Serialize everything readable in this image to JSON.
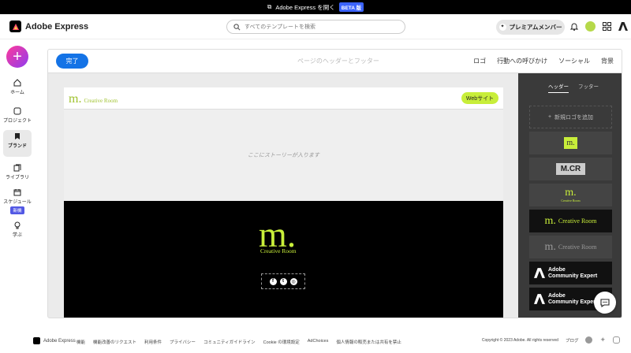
{
  "banner": {
    "text": "Adobe Express を開く",
    "badge": "BETA 版"
  },
  "header": {
    "app_name": "Adobe Express",
    "search_placeholder": "すべてのテンプレートを検索",
    "premium_label": "プレミアムメンバー"
  },
  "nav": {
    "items": [
      {
        "label": "ホーム",
        "icon": "home-icon"
      },
      {
        "label": "プロジェクト",
        "icon": "folder-icon"
      },
      {
        "label": "ブランド",
        "icon": "brand-icon"
      },
      {
        "label": "ライブラリ",
        "icon": "library-icon"
      },
      {
        "label": "スケジュール",
        "icon": "calendar-icon",
        "badge": "新機"
      },
      {
        "label": "学ぶ",
        "icon": "lightbulb-icon"
      }
    ]
  },
  "toolbar": {
    "done_label": "完了",
    "title": "ページのヘッダーとフッター",
    "tabs": [
      "ロゴ",
      "行動への呼びかけ",
      "ソーシャル",
      "背景"
    ]
  },
  "canvas": {
    "logo_m": "m.",
    "logo_text": "Creative Room",
    "web_button": "Webサイト",
    "story_placeholder": "ここにストーリーが入ります",
    "footer_m": "m.",
    "footer_text": "Creative Room"
  },
  "panel": {
    "tabs": [
      "ヘッダー",
      "フッター"
    ],
    "add_logo": "新規ロゴを追加",
    "logos": [
      {
        "kind": "m-box",
        "text": "m."
      },
      {
        "kind": "mcr",
        "text": "M.CR"
      },
      {
        "kind": "m-small",
        "text": "m.",
        "sub": "Creative Room"
      },
      {
        "kind": "m-wide",
        "text": "m.",
        "sub": "Creative Room"
      },
      {
        "kind": "m-wide-gray",
        "text": "m.",
        "sub": "Creative Room"
      },
      {
        "kind": "adobe",
        "text": "Adobe",
        "sub": "Community Expert"
      },
      {
        "kind": "adobe",
        "text": "Adobe",
        "sub": "Community Expert"
      }
    ]
  },
  "footer": {
    "app_name": "Adobe Express",
    "links": [
      "機能",
      "機能改善のリクエスト",
      "利用条件",
      "プライバシー",
      "コミュニティガイドライン",
      "Cookie の環境設定",
      "AdChoices",
      "個人情報の販売または共有を禁止"
    ],
    "copyright": "Copyright © 2023 Adobe. All rights reserved",
    "blog": "ブログ"
  }
}
